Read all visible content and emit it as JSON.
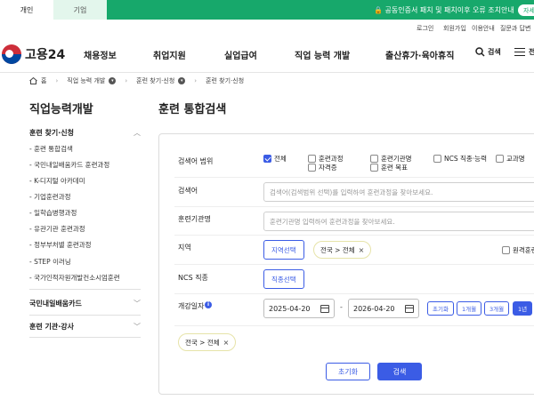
{
  "top": {
    "tab_personal": "개인",
    "tab_company": "기업",
    "notice": "🔒 공동인증서 패치 및 패치이후 오류 조치안내",
    "notice_more": "자세"
  },
  "util": [
    "로그인",
    "회원가입",
    "이용안내",
    "질문과 답변"
  ],
  "header": {
    "logo": "고용24",
    "nav": [
      "채용정보",
      "취업지원",
      "실업급여",
      "직업 능력 개발",
      "출산휴가·육아휴직"
    ],
    "search": "검색",
    "menu": "전"
  },
  "breadcrumb": [
    "홈",
    "직업 능력 개발",
    "훈련 찾기·신청",
    "훈련 찾기·신청"
  ],
  "lnb": {
    "title": "직업능력개발",
    "group1": "훈련 찾기·신청",
    "items": [
      "- 훈련 통합검색",
      "- 국민내일배움카드 훈련과정",
      "- K-디지털 아카데미",
      "- 기업훈련과정",
      "- 일학습병행과정",
      "- 유관기관 훈련과정",
      "- 정부부처별 훈련과정",
      "- STEP 이러닝",
      "- 국가인적자원개발컨소시엄훈련"
    ],
    "group2": "국민내일배움카드",
    "group3": "훈련 기관·강사"
  },
  "main": {
    "title": "훈련 통합검색",
    "scope_label": "검색어 범위",
    "scope_options": [
      "전체",
      "훈련과정",
      "훈련기관명",
      "NCS 직종·능력",
      "교과명",
      "자격증",
      "훈련 목표"
    ],
    "keyword_label": "검색어",
    "keyword_placeholder": "검색어(검색범위 선택)를 입력하여 훈련과정을 찾아보세요.",
    "org_label": "훈련기관명",
    "org_placeholder": "훈련기관명 입력하여 훈련과정을 찾아보세요.",
    "region_label": "지역",
    "region_button": "지역선택",
    "region_chip": "전국 > 전체",
    "remote_label": "원격훈련",
    "ncs_label": "NCS 직종",
    "ncs_button": "직종선택",
    "date_label": "개강일자",
    "date_from": "2025-04-20",
    "date_sep": "-",
    "date_to": "2026-04-20",
    "periods": [
      "초기화",
      "1개월",
      "3개월",
      "1년"
    ],
    "summary_chip": "전국 > 전체",
    "reset": "초기화",
    "search": "검색"
  }
}
